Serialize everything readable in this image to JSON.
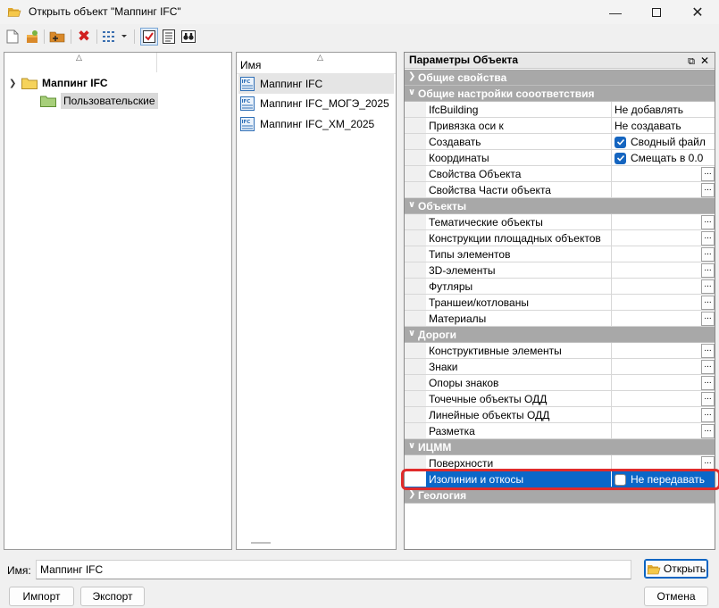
{
  "window": {
    "title": "Открыть объект \"Маппинг IFC\""
  },
  "toolbar": {
    "icons": [
      "new-document-icon",
      "open-object-icon",
      "add-folder-icon",
      "delete-icon",
      "view-mode-icon",
      "checkbox-icon",
      "text-document-icon",
      "binoculars-icon"
    ]
  },
  "tree": {
    "root_label": "Маппинг IFC",
    "child_label": "Пользовательские"
  },
  "list": {
    "header": "Имя",
    "items": [
      "Маппинг IFC",
      "Маппинг IFC_МОГЭ_2025",
      "Маппинг IFC_XM_2025"
    ]
  },
  "props": {
    "title": "Параметры Объекта",
    "sections": [
      {
        "label": "Общие свойства"
      },
      {
        "label": "Общие настройки сооответствия"
      },
      {
        "label": "Объекты"
      },
      {
        "label": "Дороги"
      },
      {
        "label": "ИЦММ"
      },
      {
        "label": "Геология"
      }
    ],
    "rows": {
      "ifcbuilding": {
        "name": "IfcBuilding",
        "value": "Не добавлять"
      },
      "axis": {
        "name": "Привязка оси к",
        "value": "Не создавать"
      },
      "create": {
        "name": "Создавать",
        "value": "Сводный файл"
      },
      "coords": {
        "name": "Координаты",
        "value": "Смещать в 0.0"
      },
      "obj_props": {
        "name": "Свойства Объекта"
      },
      "part_props": {
        "name": "Свойства Части объекта"
      },
      "thematic": {
        "name": "Тематические объекты"
      },
      "area": {
        "name": "Конструкции площадных объектов"
      },
      "types": {
        "name": "Типы элементов"
      },
      "elements3d": {
        "name": "3D-элементы"
      },
      "cases": {
        "name": "Футляры"
      },
      "trenches": {
        "name": "Траншеи/котлованы"
      },
      "materials": {
        "name": "Материалы"
      },
      "structural": {
        "name": "Конструктивные элементы"
      },
      "signs": {
        "name": "Знаки"
      },
      "sign_supports": {
        "name": "Опоры знаков"
      },
      "point_odd": {
        "name": "Точечные объекты ОДД"
      },
      "line_odd": {
        "name": "Линейные объекты ОДД"
      },
      "markings": {
        "name": "Разметка"
      },
      "surfaces": {
        "name": "Поверхности"
      },
      "isolines": {
        "name": "Изолинии и откосы",
        "value": "Не передавать"
      }
    },
    "ellipsis_label": "..."
  },
  "footer": {
    "name_label": "Имя:",
    "name_value": "Маппинг IFC",
    "open_label": "Открыть",
    "import_label": "Импорт",
    "export_label": "Экспорт",
    "cancel_label": "Отмена"
  },
  "colors": {
    "selection": "#0b67c8",
    "highlight": "#e02b2b",
    "category": "#a8a8a8"
  }
}
